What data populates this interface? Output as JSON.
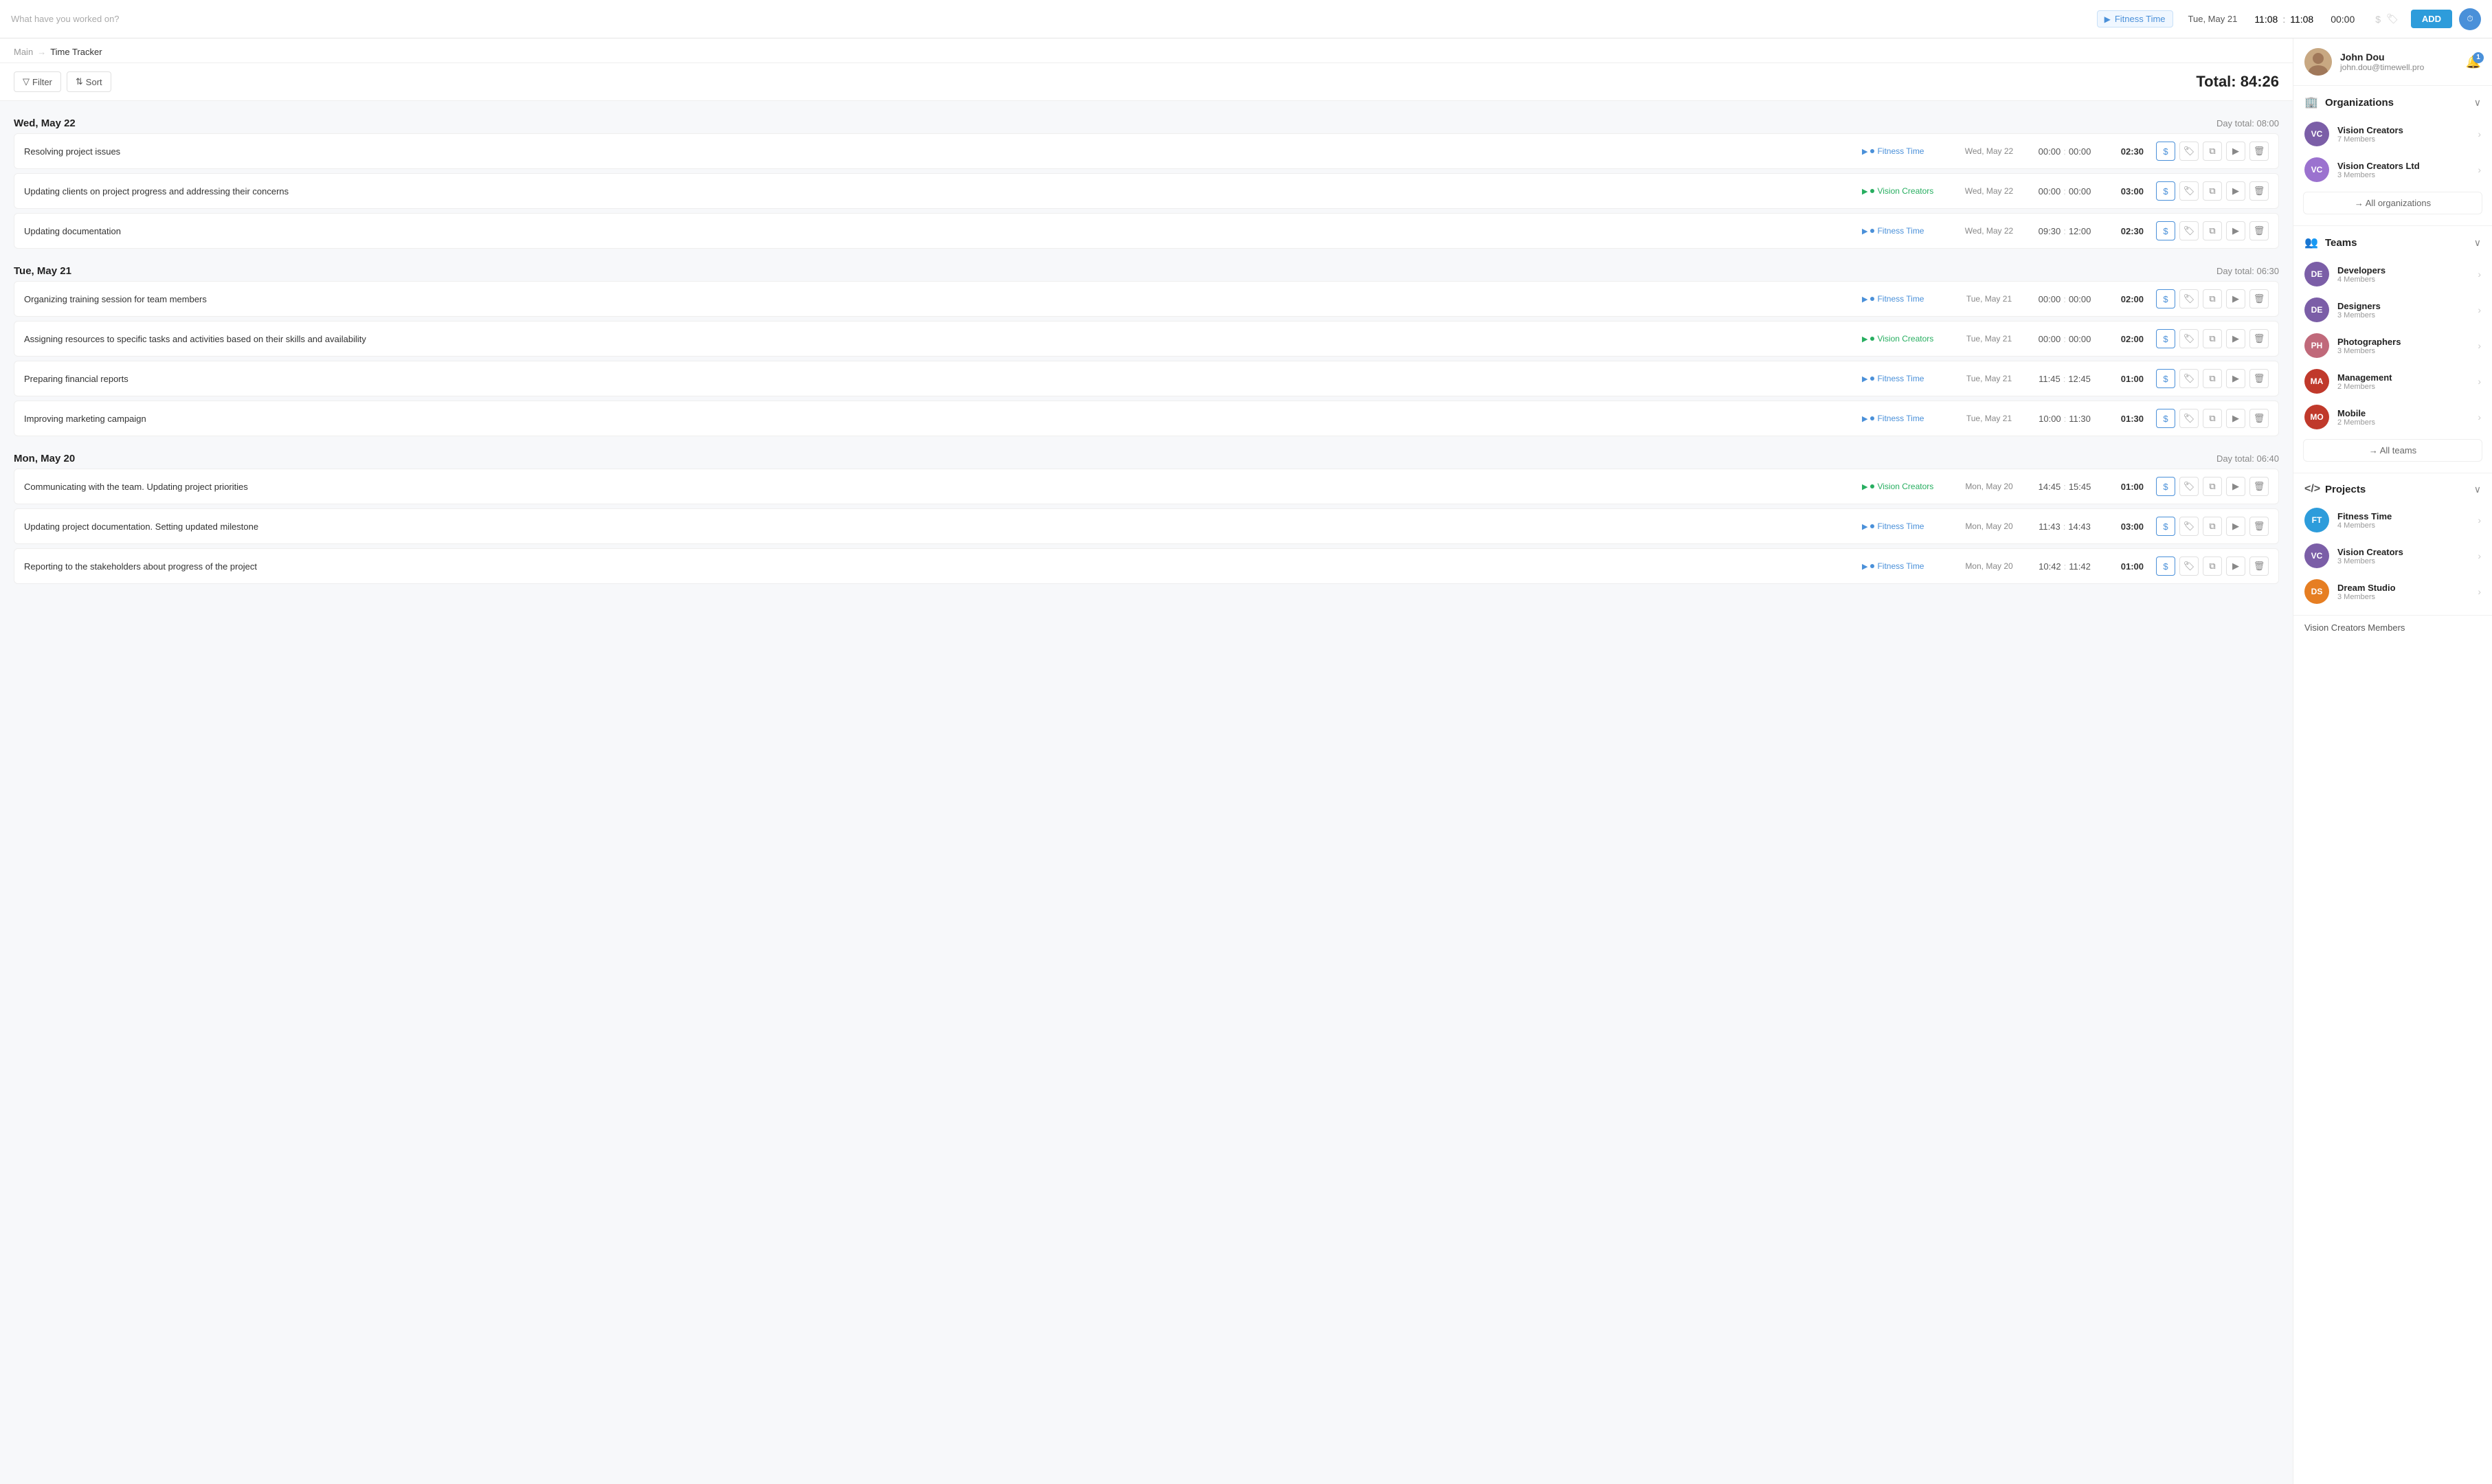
{
  "topbar": {
    "search_placeholder": "What have you worked on?",
    "current_project": "Fitness Time",
    "current_date": "Tue, May 21",
    "time_start": "11:08",
    "time_sep": ":",
    "time_end": "11:08",
    "duration": "00:00",
    "add_label": "ADD"
  },
  "breadcrumb": {
    "main": "Main",
    "sep": "→",
    "current": "Time Tracker"
  },
  "toolbar": {
    "filter_label": "Filter",
    "sort_label": "Sort",
    "total_label": "Total: 84:26"
  },
  "days": [
    {
      "title": "Wed, May 22",
      "total": "Day total: 08:00",
      "entries": [
        {
          "desc": "Resolving project issues",
          "project": "Fitness Time",
          "project_color": "blue",
          "date": "Wed, May 22",
          "time_start": "00:00",
          "time_end": "00:00",
          "duration": "02:30"
        },
        {
          "desc": "Updating clients on project progress and addressing their concerns",
          "project": "Vision Creators",
          "project_color": "green",
          "date": "Wed, May 22",
          "time_start": "00:00",
          "time_end": "00:00",
          "duration": "03:00"
        },
        {
          "desc": "Updating documentation",
          "project": "Fitness Time",
          "project_color": "blue",
          "date": "Wed, May 22",
          "time_start": "09:30",
          "time_end": "12:00",
          "duration": "02:30"
        }
      ]
    },
    {
      "title": "Tue, May 21",
      "total": "Day total: 06:30",
      "entries": [
        {
          "desc": "Organizing training session for team members",
          "project": "Fitness Time",
          "project_color": "blue",
          "date": "Tue, May 21",
          "time_start": "00:00",
          "time_end": "00:00",
          "duration": "02:00"
        },
        {
          "desc": "Assigning resources to specific tasks and activities based on their skills and availability",
          "project": "Vision Creators",
          "project_color": "green",
          "date": "Tue, May 21",
          "time_start": "00:00",
          "time_end": "00:00",
          "duration": "02:00"
        },
        {
          "desc": "Preparing financial reports",
          "project": "Fitness Time",
          "project_color": "blue",
          "date": "Tue, May 21",
          "time_start": "11:45",
          "time_end": "12:45",
          "duration": "01:00"
        },
        {
          "desc": "Improving marketing campaign",
          "project": "Fitness Time",
          "project_color": "blue",
          "date": "Tue, May 21",
          "time_start": "10:00",
          "time_end": "11:30",
          "duration": "01:30"
        }
      ]
    },
    {
      "title": "Mon, May 20",
      "total": "Day total: 06:40",
      "entries": [
        {
          "desc": "Communicating with the team. Updating project priorities",
          "project": "Vision Creators",
          "project_color": "green",
          "date": "Mon, May 20",
          "time_start": "14:45",
          "time_end": "15:45",
          "duration": "01:00"
        },
        {
          "desc": "Updating project documentation. Setting updated milestone",
          "project": "Fitness Time",
          "project_color": "blue",
          "date": "Mon, May 20",
          "time_start": "11:43",
          "time_end": "14:43",
          "duration": "03:00"
        },
        {
          "desc": "Reporting to the stakeholders about progress of the project",
          "project": "Fitness Time",
          "project_color": "blue",
          "date": "Mon, May 20",
          "time_start": "10:42",
          "time_end": "11:42",
          "duration": "01:00"
        }
      ]
    }
  ],
  "sidebar": {
    "user": {
      "name": "John Dou",
      "email": "john.dou@timewell.pro",
      "notif_count": "1"
    },
    "organizations": {
      "title": "Organizations",
      "items": [
        {
          "initials": "VC",
          "name": "Vision Creators",
          "meta": "7 Members",
          "color": "vc-purple"
        },
        {
          "initials": "VC",
          "name": "Vision Creators Ltd",
          "meta": "3 Members",
          "color": "vc-light"
        }
      ],
      "all_label": "→ All organizations"
    },
    "teams": {
      "title": "Teams",
      "items": [
        {
          "initials": "DE",
          "name": "Developers",
          "meta": "4 Members",
          "color": "de-purple"
        },
        {
          "initials": "DE",
          "name": "Designers",
          "meta": "3 Members",
          "color": "de-purple"
        },
        {
          "initials": "PH",
          "name": "Photographers",
          "meta": "3 Members",
          "color": "ph-pink"
        },
        {
          "initials": "MA",
          "name": "Management",
          "meta": "2 Members",
          "color": "ma-red"
        },
        {
          "initials": "MO",
          "name": "Mobile",
          "meta": "2 Members",
          "color": "mo-red"
        }
      ],
      "all_label": "→ All teams"
    },
    "projects": {
      "title": "Projects",
      "items": [
        {
          "initials": "FT",
          "name": "Fitness Time",
          "meta": "4 Members",
          "color": "ft-blue"
        },
        {
          "initials": "VC",
          "name": "Vision Creators",
          "meta": "3 Members",
          "color": "vc-purple"
        },
        {
          "initials": "DS",
          "name": "Dream Studio",
          "meta": "3 Members",
          "color": "ds-orange"
        }
      ]
    },
    "members_label": "Vision Creators Members"
  }
}
